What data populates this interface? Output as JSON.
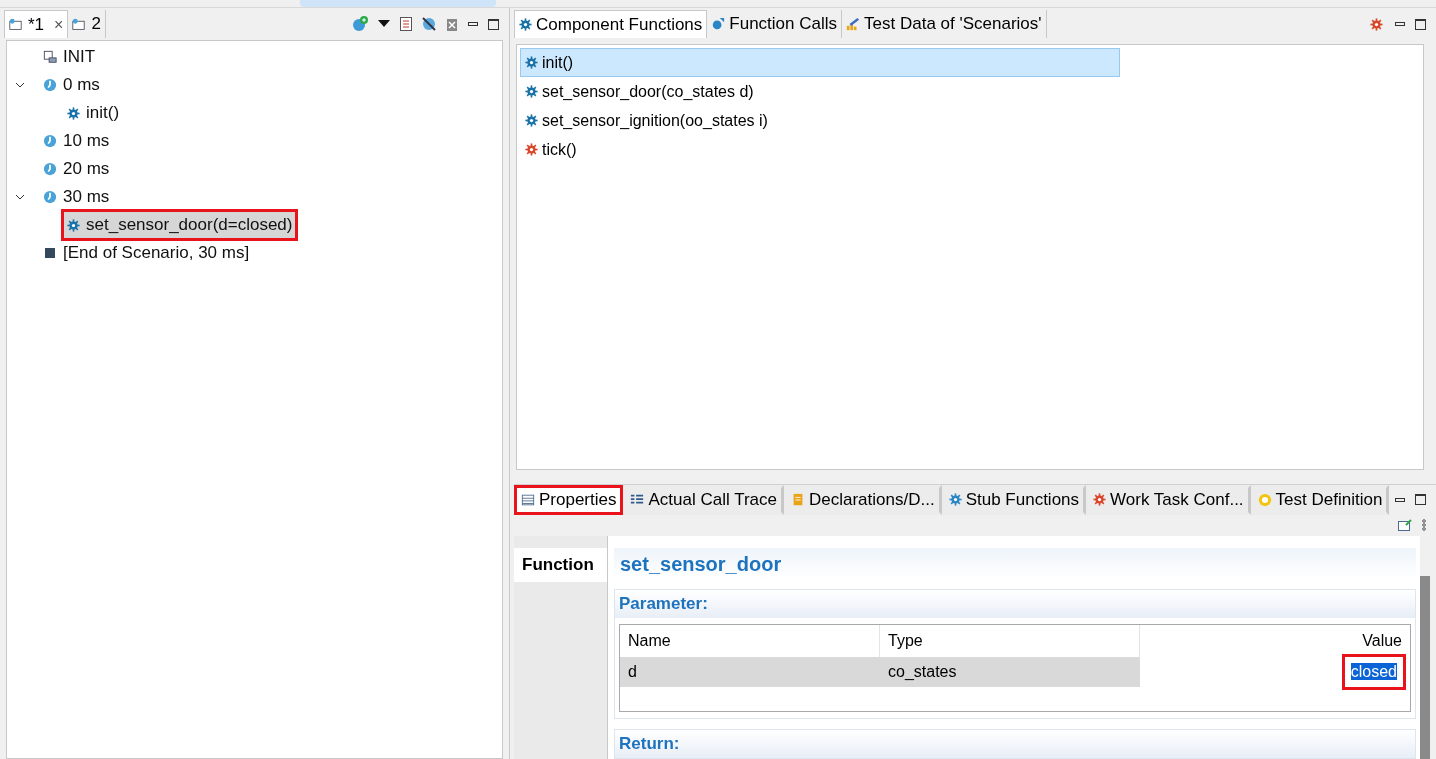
{
  "left_panel": {
    "tabs": [
      {
        "label": "*1",
        "selected": true,
        "close": "×"
      },
      {
        "label": "2",
        "selected": false
      }
    ],
    "tree": [
      {
        "kind": "init",
        "label": "INIT",
        "selected": false,
        "annotated": false
      },
      {
        "kind": "time",
        "label": "0 ms",
        "selected": false,
        "annotated": false,
        "expanded": true,
        "children": [
          {
            "kind": "call",
            "label": "init()",
            "selected": false,
            "annotated": false
          }
        ]
      },
      {
        "kind": "time",
        "label": "10 ms",
        "selected": false,
        "annotated": false
      },
      {
        "kind": "time",
        "label": "20 ms",
        "selected": false,
        "annotated": false
      },
      {
        "kind": "time",
        "label": "30 ms",
        "selected": false,
        "annotated": false,
        "expanded": true,
        "children": [
          {
            "kind": "call",
            "label": "set_sensor_door(d=closed)",
            "selected": true,
            "annotated": true
          }
        ]
      },
      {
        "kind": "end",
        "label": "[End of Scenario, 30 ms]",
        "selected": false,
        "annotated": false
      }
    ]
  },
  "top_panel": {
    "tabs": [
      {
        "label": "Component Functions",
        "kind": "gear",
        "selected": true
      },
      {
        "label": "Function Calls",
        "kind": "calls",
        "selected": false
      },
      {
        "label": "Test Data of 'Scenarios'",
        "kind": "data",
        "selected": false
      }
    ],
    "functions": [
      {
        "label": "init()",
        "kind": "function",
        "selected": true
      },
      {
        "label": "set_sensor_door(co_states d)",
        "kind": "function",
        "selected": false
      },
      {
        "label": "set_sensor_ignition(oo_states i)",
        "kind": "function",
        "selected": false
      },
      {
        "label": "tick()",
        "kind": "task",
        "selected": false
      }
    ]
  },
  "bottom_panel": {
    "tabs": [
      {
        "label": "Properties",
        "kind": "table",
        "selected": true,
        "annotated": true
      },
      {
        "label": "Actual Call Trace",
        "kind": "trace",
        "selected": false,
        "annotated": false
      },
      {
        "label": "Declarations/D...",
        "kind": "decl",
        "selected": false,
        "annotated": false
      },
      {
        "label": "Stub Functions",
        "kind": "stub",
        "selected": false,
        "annotated": false
      },
      {
        "label": "Work Task Conf...",
        "kind": "task",
        "selected": false,
        "annotated": false
      },
      {
        "label": "Test Definition",
        "kind": "target",
        "selected": false,
        "annotated": false
      }
    ],
    "side_tabs": [
      {
        "label": "Function",
        "selected": true
      }
    ],
    "title": "set_sensor_door",
    "parameter_section": "Parameter:",
    "columns": [
      "Name",
      "Type",
      "Value"
    ],
    "rows": [
      {
        "cells": [
          "d",
          "co_states",
          "closed"
        ],
        "selected": true,
        "value_selected": true,
        "value_annotated": true
      }
    ],
    "return_section": "Return:"
  }
}
